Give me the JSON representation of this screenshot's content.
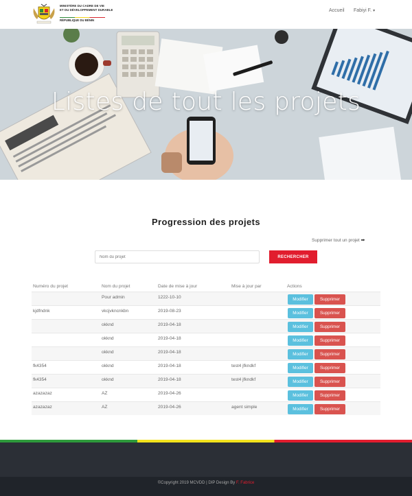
{
  "header": {
    "ministry_line1": "MINISTÈRE DU CADRE DE VIE",
    "ministry_line2": "ET DU DÉVELOPPEMENT DURABLE",
    "republic": "RÉPUBLIQUE DU BÉNIN",
    "nav_home": "Accueil",
    "nav_user": "Fabiyi F."
  },
  "hero": {
    "title": "Listes de tout les projets"
  },
  "section": {
    "title": "Progression des projets",
    "delete_all": "Supprimer tout un projet",
    "search_placeholder": "Nom du projet",
    "search_button": "RECHERCHER"
  },
  "table": {
    "headers": [
      "Numéro du projet",
      "Nom du projet",
      "Date de mise à jour",
      "Mise à jour par",
      "Actions"
    ],
    "edit_label": "Modifier",
    "delete_label": "Supprimer",
    "rows": [
      {
        "numero": "",
        "nom": "Pour admin",
        "date": "1222-10-10",
        "par": ""
      },
      {
        "numero": "kjdfndnk",
        "nom": "vkcjvkncnkbn",
        "date": "2019-08-23",
        "par": ""
      },
      {
        "numero": "",
        "nom": "okknd",
        "date": "2019-04-18",
        "par": ""
      },
      {
        "numero": "",
        "nom": "okknd",
        "date": "2019-04-18",
        "par": ""
      },
      {
        "numero": "",
        "nom": "okknd",
        "date": "2019-04-18",
        "par": ""
      },
      {
        "numero": "fk4354",
        "nom": "okknd",
        "date": "2019-04-18",
        "par": "test4 jfkndkf"
      },
      {
        "numero": "fk4354",
        "nom": "okknd",
        "date": "2019-04-18",
        "par": "test4 jfkndkf"
      },
      {
        "numero": "azazazaz",
        "nom": "AZ",
        "date": "2019-04-26",
        "par": ""
      },
      {
        "numero": "azazazaz",
        "nom": "AZ",
        "date": "2019-04-26",
        "par": "agent simple"
      }
    ]
  },
  "footer": {
    "copyright": "©Copyright 2019 MCVDD | DIP Design By",
    "designer": "F. Fabrice"
  },
  "colors": {
    "accent_red": "#e11d2e",
    "edit_button": "#5bc0de",
    "delete_button": "#d9534f",
    "footer_bg": "#2b2f36"
  }
}
